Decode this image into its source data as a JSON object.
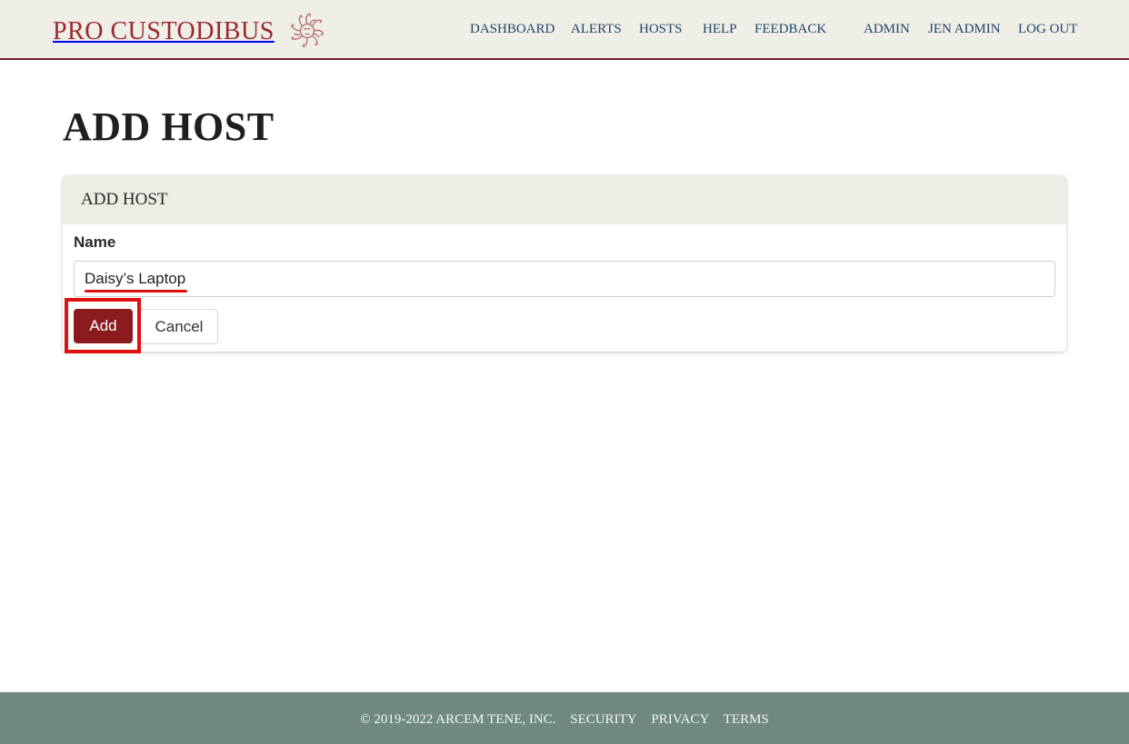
{
  "header": {
    "brand": "PRO CUSTODIBUS",
    "logo_icon": "medusa-head-icon",
    "nav": {
      "dashboard": "DASHBOARD",
      "alerts": "ALERTS",
      "hosts": "HOSTS",
      "help": "HELP",
      "feedback": "FEEDBACK",
      "admin": "ADMIN",
      "user": "JEN ADMIN",
      "logout": "LOG OUT"
    }
  },
  "main": {
    "page_title": "ADD HOST",
    "card": {
      "title": "ADD HOST",
      "name_label": "Name",
      "name_value": "Daisy’s Laptop",
      "add_label": "Add",
      "cancel_label": "Cancel"
    }
  },
  "footer": {
    "copyright": "© 2019-2022 ARCEM TENE, INC.",
    "security": "SECURITY",
    "privacy": "PRIVACY",
    "terms": "TERMS"
  },
  "colors": {
    "brand": "#9b2a2f",
    "primary_button": "#8b1a1e",
    "nav_link": "#1f4666",
    "header_bg": "#efeee7",
    "footer_bg": "#708a80",
    "annotation": "#e01010"
  }
}
